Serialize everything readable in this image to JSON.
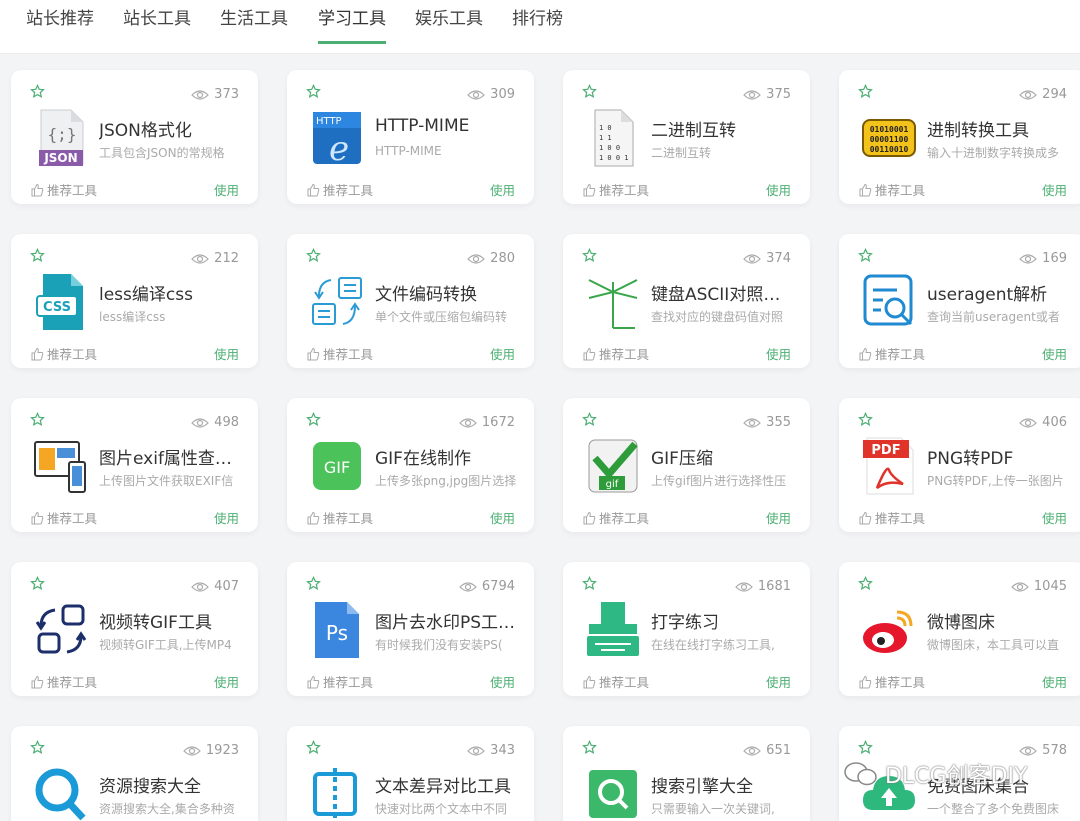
{
  "nav": {
    "tabs": [
      "站长推荐",
      "站长工具",
      "生活工具",
      "学习工具",
      "娱乐工具",
      "排行榜"
    ],
    "active_index": 3
  },
  "labels": {
    "recommend": "推荐工具",
    "use": "使用"
  },
  "cards": [
    {
      "icon": "json-file-icon",
      "views": "373",
      "title": "JSON格式化",
      "desc": "工具包含JSON的常规格"
    },
    {
      "icon": "http-mime-icon",
      "views": "309",
      "title": "HTTP-MIME",
      "desc": "HTTP-MIME"
    },
    {
      "icon": "binary-file-icon",
      "views": "375",
      "title": "二进制互转",
      "desc": "二进制互转"
    },
    {
      "icon": "binary-chip-icon",
      "views": "294",
      "title": "进制转换工具",
      "desc": "输入十进制数字转换成多"
    },
    {
      "icon": "css-file-icon",
      "views": "212",
      "title": "less编译css",
      "desc": "less编译css"
    },
    {
      "icon": "file-convert-icon",
      "views": "280",
      "title": "文件编码转换",
      "desc": "单个文件或压缩包编码转"
    },
    {
      "icon": "antenna-icon",
      "views": "374",
      "title": "键盘ASCII对照…",
      "desc": "查找对应的键盘码值对照"
    },
    {
      "icon": "document-search-icon",
      "views": "169",
      "title": "useragent解析",
      "desc": "查询当前useragent或者"
    },
    {
      "icon": "devices-icon",
      "views": "498",
      "title": "图片exif属性查…",
      "desc": "上传图片文件获取EXIF信"
    },
    {
      "icon": "gif-icon",
      "views": "1672",
      "title": "GIF在线制作",
      "desc": "上传多张png,jpg图片选择"
    },
    {
      "icon": "gif-compress-icon",
      "views": "355",
      "title": "GIF压缩",
      "desc": "上传gif图片进行选择性压"
    },
    {
      "icon": "pdf-icon",
      "views": "406",
      "title": "PNG转PDF",
      "desc": "PNG转PDF,上传一张图片"
    },
    {
      "icon": "video-gif-icon",
      "views": "407",
      "title": "视频转GIF工具",
      "desc": "视频转GIF工具,上传MP4"
    },
    {
      "icon": "photoshop-icon",
      "views": "6794",
      "title": "图片去水印PS工…",
      "desc": "有时候我们没有安装PS("
    },
    {
      "icon": "typewriter-icon",
      "views": "1681",
      "title": "打字练习",
      "desc": "在线在线打字练习工具,"
    },
    {
      "icon": "weibo-icon",
      "views": "1045",
      "title": "微博图床",
      "desc": "微博图床，本工具可以直"
    },
    {
      "icon": "search-icon",
      "views": "1923",
      "title": "资源搜索大全",
      "desc": "资源搜索大全,集合多种资"
    },
    {
      "icon": "text-diff-icon",
      "views": "343",
      "title": "文本差异对比工具",
      "desc": "快速对比两个文本中不同"
    },
    {
      "icon": "search-engine-icon",
      "views": "651",
      "title": "搜索引擎大全",
      "desc": "只需要输入一次关键词,"
    },
    {
      "icon": "image-upload-icon",
      "views": "578",
      "title": "免费图床集合",
      "desc": "一个整合了多个免费图床"
    }
  ],
  "watermark": "DLCG创客DIY"
}
